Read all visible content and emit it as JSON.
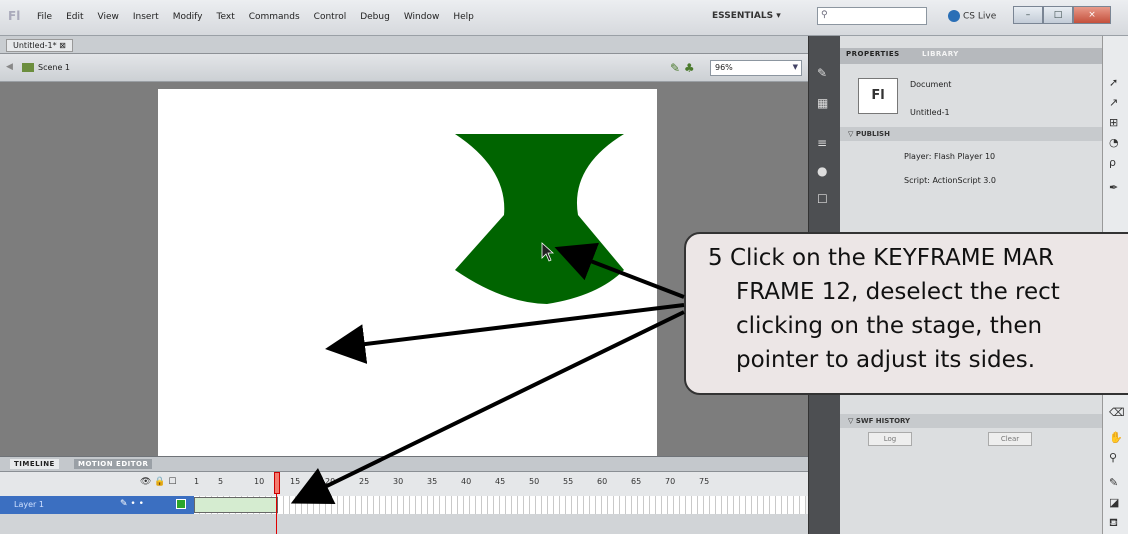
{
  "menubar": {
    "logo": "Fl",
    "items": [
      "File",
      "Edit",
      "View",
      "Insert",
      "Modify",
      "Text",
      "Commands",
      "Control",
      "Debug",
      "Window",
      "Help"
    ],
    "workspace": "ESSENTIALS ▾",
    "cs_live": "CS Live",
    "window_buttons": [
      "–",
      "□",
      "×"
    ]
  },
  "document": {
    "tab_title": "Untitled-1* ⊠",
    "scene_label": "Scene 1",
    "zoom": "96%"
  },
  "timeline": {
    "tabs": [
      "TIMELINE",
      "MOTION EDITOR"
    ],
    "header_icons": "👁 🔒 ☐",
    "frame_numbers": [
      "1",
      "5",
      "10",
      "15",
      "20",
      "25",
      "30",
      "35",
      "40",
      "45",
      "50",
      "55",
      "60",
      "65",
      "70",
      "75"
    ],
    "layer_name": "Layer 1",
    "playhead_frame": 12
  },
  "properties": {
    "tabs": [
      "PROPERTIES",
      "LIBRARY"
    ],
    "doc_icon": "Fl",
    "doc_type": "Document",
    "doc_name": "Untitled-1",
    "publish_header": "PUBLISH",
    "player": "Player: Flash Player 10",
    "script": "Script: ActionScript 3.0",
    "swf_header": "SWF HISTORY",
    "log_button": "Log",
    "clear_button": "Clear"
  },
  "callout": {
    "lines": [
      "5  Click on the KEYFRAME MAR",
      "FRAME 12, deselect the rect",
      "clicking on the stage, then",
      "pointer to adjust its sides."
    ]
  },
  "colors": {
    "shape_fill": "#006400",
    "layer_selected": "#3b6fc1",
    "playhead": "#e00000",
    "tween_fill": "#d5ecd0"
  }
}
